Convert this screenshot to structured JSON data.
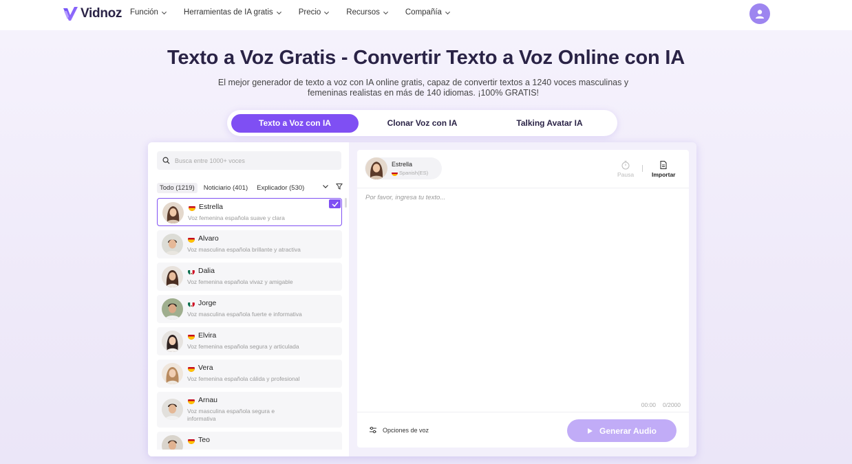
{
  "header": {
    "brand": "Vidnoz",
    "nav": [
      "Función",
      "Herramientas de IA gratis",
      "Precio",
      "Recursos",
      "Compañía"
    ]
  },
  "hero": {
    "title": "Texto a Voz Gratis - Convertir Texto a Voz Online con IA",
    "subtitle_line1": "El mejor generador de texto a voz con IA online gratis, capaz de convertir textos a 1240 voces masculinas y",
    "subtitle_line2": "femeninas realistas en más de 140 idiomas. ¡100% GRATIS!"
  },
  "tabs": [
    "Texto a Voz con IA",
    "Clonar Voz con IA",
    "Talking Avatar IA"
  ],
  "search": {
    "placeholder": "Busca entre 1000+ voces"
  },
  "filters": [
    "Todo (1219)",
    "Noticiario (401)",
    "Explicador (530)"
  ],
  "voices": [
    {
      "name": "Estrella",
      "desc": "Voz femenina española suave y clara",
      "flag": "es",
      "selected": true
    },
    {
      "name": "Alvaro",
      "desc": "Voz masculina española brillante y atractiva",
      "flag": "es"
    },
    {
      "name": "Dalia",
      "desc": "Voz femenina española vivaz y amigable",
      "flag": "mx"
    },
    {
      "name": "Jorge",
      "desc": "Voz masculina española fuerte e informativa",
      "flag": "mx"
    },
    {
      "name": "Elvira",
      "desc": "Voz femenina española segura y articulada",
      "flag": "es"
    },
    {
      "name": "Vera",
      "desc": "Voz femenina española cálida y profesional",
      "flag": "es"
    },
    {
      "name": "Arnau",
      "desc": "Voz masculina española segura e informativa",
      "flag": "es"
    },
    {
      "name": "Teo",
      "desc": "",
      "flag": "es"
    }
  ],
  "editor": {
    "speaker_name": "Estrella",
    "speaker_lang": "Spanish(ES)",
    "pause_label": "Pausa",
    "import_label": "Importar",
    "placeholder": "Por favor, ingresa tu texto...",
    "time": "00:00",
    "count": "0/2000",
    "options_label": "Opciones de voz",
    "generate_label": "Generar Audio"
  },
  "colors": {
    "accent": "#7f4ff3",
    "accent_light": "#c1acf7",
    "avatar": "#9d85f0"
  }
}
